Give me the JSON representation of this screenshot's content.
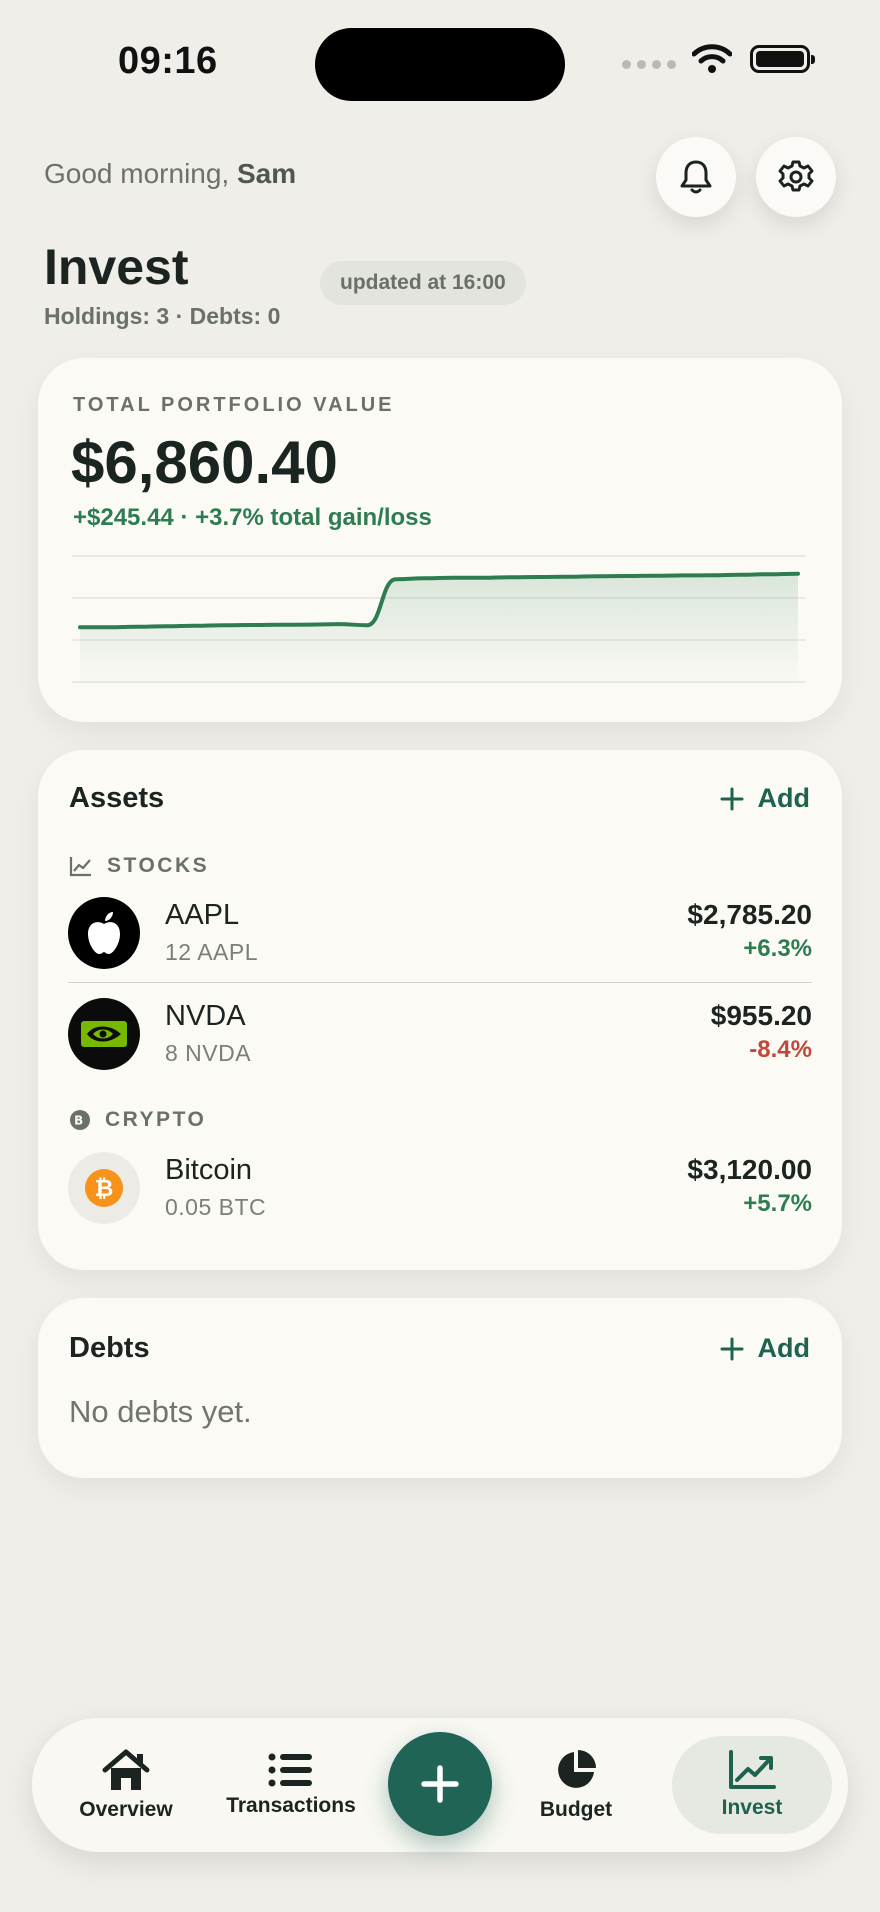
{
  "status_bar": {
    "time": "09:16"
  },
  "header": {
    "greeting_prefix": "Good morning,",
    "user_name": "Sam",
    "title": "Invest",
    "updated": "updated at 16:00",
    "subtitle": "Holdings: 3 · Debts: 0"
  },
  "portfolio": {
    "label": "TOTAL PORTFOLIO VALUE",
    "value": "$6,860.40",
    "change": "+$245.44 · +3.7% total gain/loss",
    "trend": [
      0.62,
      0.62,
      0.615,
      0.61,
      0.605,
      0.6,
      0.598,
      0.596,
      0.594,
      0.59,
      0.6,
      0.15,
      0.14,
      0.135,
      0.135,
      0.13,
      0.128,
      0.125,
      0.12,
      0.118,
      0.115,
      0.112,
      0.11,
      0.105,
      0.1,
      0.095
    ]
  },
  "assets": {
    "title": "Assets",
    "add_label": "Add",
    "sections": [
      {
        "name": "STOCKS",
        "icon": "chart-line-icon",
        "items": [
          {
            "name": "AAPL",
            "qty": "12 AAPL",
            "value": "$2,785.20",
            "change": "+6.3%",
            "direction": "up",
            "logo": "apple-logo-icon"
          },
          {
            "name": "NVDA",
            "qty": "8 NVDA",
            "value": "$955.20",
            "change": "-8.4%",
            "direction": "down",
            "logo": "nvidia-logo-icon"
          }
        ]
      },
      {
        "name": "CRYPTO",
        "icon": "bitcoin-small-icon",
        "items": [
          {
            "name": "Bitcoin",
            "qty": "0.05 BTC",
            "value": "$3,120.00",
            "change": "+5.7%",
            "direction": "up",
            "logo": "bitcoin-logo-icon"
          }
        ]
      }
    ]
  },
  "debts": {
    "title": "Debts",
    "add_label": "Add",
    "empty": "No debts yet."
  },
  "nav": {
    "items": [
      {
        "label": "Overview",
        "icon": "home-icon"
      },
      {
        "label": "Transactions",
        "icon": "list-icon"
      },
      {
        "label": "Budget",
        "icon": "pie-chart-icon"
      },
      {
        "label": "Invest",
        "icon": "trending-up-icon"
      }
    ],
    "active": "Invest",
    "fab_icon": "plus-icon"
  },
  "colors": {
    "accent": "#1f6455",
    "positive": "#2e7d50",
    "negative": "#c0483a",
    "background": "#efeee9",
    "card": "#fbfaf5"
  }
}
